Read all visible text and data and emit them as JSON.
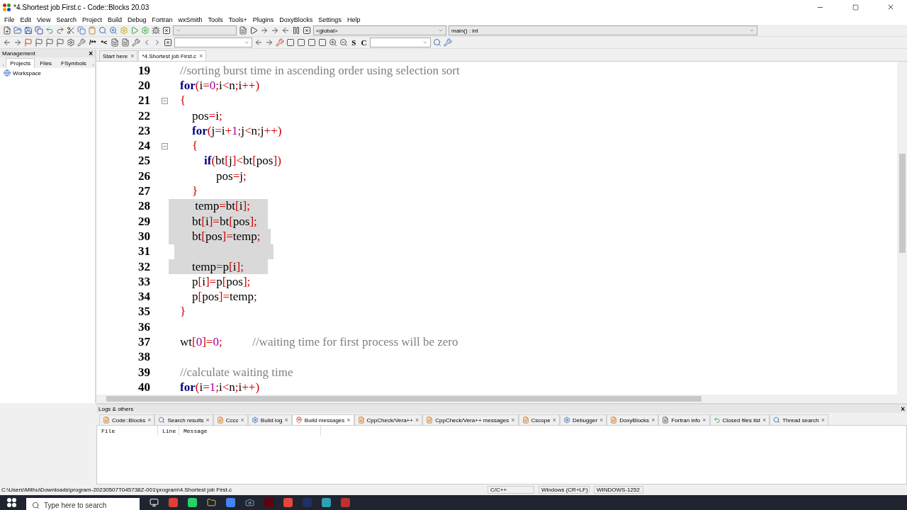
{
  "window": {
    "title": "*4.Shortest job First.c - Code::Blocks 20.03"
  },
  "menu": [
    "File",
    "Edit",
    "View",
    "Search",
    "Project",
    "Build",
    "Debug",
    "Fortran",
    "wxSmith",
    "Tools",
    "Tools+",
    "Plugins",
    "DoxyBlocks",
    "Settings",
    "Help"
  ],
  "toolbar": {
    "scope": "<global>",
    "function": "main() : int",
    "doc_buttons": [
      "/**",
      "*<"
    ],
    "style_buttons": [
      "S",
      "C"
    ]
  },
  "management": {
    "title": "Management",
    "close": "×",
    "tabs": [
      {
        "label": "Projects",
        "selected": true
      },
      {
        "label": "Files",
        "selected": false
      },
      {
        "label": "FSymbols",
        "selected": false
      }
    ],
    "tree": [
      "Workspace"
    ]
  },
  "editor": {
    "tabs": [
      {
        "label": "Start here",
        "close": "×",
        "selected": false
      },
      {
        "label": "*4.Shortest job First.c",
        "close": "×",
        "selected": true
      }
    ],
    "lines": [
      {
        "number": "19",
        "fold": false,
        "selected": false,
        "tokens": [
          {
            "text": "//sorting burst time in ascending order using selection sort",
            "kind": "comment"
          }
        ]
      },
      {
        "number": "20",
        "fold": false,
        "selected": false,
        "tokens": [
          {
            "text": "for",
            "kind": "keyword"
          },
          {
            "text": "(",
            "kind": "operator"
          },
          {
            "text": "i",
            "kind": "plain"
          },
          {
            "text": "=",
            "kind": "operator"
          },
          {
            "text": "0",
            "kind": "number"
          },
          {
            "text": ";",
            "kind": "operator"
          },
          {
            "text": "i",
            "kind": "plain"
          },
          {
            "text": "<",
            "kind": "operator"
          },
          {
            "text": "n",
            "kind": "plain"
          },
          {
            "text": ";",
            "kind": "operator"
          },
          {
            "text": "i",
            "kind": "plain"
          },
          {
            "text": "++)",
            "kind": "operator"
          }
        ]
      },
      {
        "number": "21",
        "fold": true,
        "selected": false,
        "tokens": [
          {
            "text": "{",
            "kind": "operator"
          }
        ]
      },
      {
        "number": "22",
        "fold": false,
        "selected": false,
        "tokens": [
          {
            "text": "    pos",
            "kind": "plain"
          },
          {
            "text": "=",
            "kind": "operator"
          },
          {
            "text": "i",
            "kind": "plain"
          },
          {
            "text": ";",
            "kind": "operator"
          }
        ]
      },
      {
        "number": "23",
        "fold": false,
        "selected": false,
        "tokens": [
          {
            "text": "    for",
            "kind": "keyword"
          },
          {
            "text": "(",
            "kind": "operator"
          },
          {
            "text": "j",
            "kind": "plain"
          },
          {
            "text": "=",
            "kind": "operator"
          },
          {
            "text": "i",
            "kind": "plain"
          },
          {
            "text": "+",
            "kind": "operator"
          },
          {
            "text": "1",
            "kind": "number"
          },
          {
            "text": ";",
            "kind": "operator"
          },
          {
            "text": "j",
            "kind": "plain"
          },
          {
            "text": "<",
            "kind": "operator"
          },
          {
            "text": "n",
            "kind": "plain"
          },
          {
            "text": ";",
            "kind": "operator"
          },
          {
            "text": "j",
            "kind": "plain"
          },
          {
            "text": "++)",
            "kind": "operator"
          }
        ]
      },
      {
        "number": "24",
        "fold": true,
        "selected": false,
        "tokens": [
          {
            "text": "    {",
            "kind": "operator"
          }
        ]
      },
      {
        "number": "25",
        "fold": false,
        "selected": false,
        "tokens": [
          {
            "text": "        if",
            "kind": "keyword"
          },
          {
            "text": "(",
            "kind": "operator"
          },
          {
            "text": "bt",
            "kind": "plain"
          },
          {
            "text": "[",
            "kind": "operator"
          },
          {
            "text": "j",
            "kind": "plain"
          },
          {
            "text": "]<",
            "kind": "operator"
          },
          {
            "text": "bt",
            "kind": "plain"
          },
          {
            "text": "[",
            "kind": "operator"
          },
          {
            "text": "pos",
            "kind": "plain"
          },
          {
            "text": "])",
            "kind": "operator"
          }
        ]
      },
      {
        "number": "26",
        "fold": false,
        "selected": false,
        "tokens": [
          {
            "text": "            pos",
            "kind": "plain"
          },
          {
            "text": "=",
            "kind": "operator"
          },
          {
            "text": "j",
            "kind": "plain"
          },
          {
            "text": ";",
            "kind": "operator"
          }
        ]
      },
      {
        "number": "27",
        "fold": false,
        "selected": false,
        "tokens": [
          {
            "text": "    }",
            "kind": "operator"
          }
        ]
      },
      {
        "number": "28",
        "fold": false,
        "selected": true,
        "tokens": [
          {
            "text": "     temp",
            "kind": "plain"
          },
          {
            "text": "=",
            "kind": "operator"
          },
          {
            "text": "bt",
            "kind": "plain"
          },
          {
            "text": "[",
            "kind": "operator"
          },
          {
            "text": "i",
            "kind": "plain"
          },
          {
            "text": "];",
            "kind": "operator"
          }
        ]
      },
      {
        "number": "29",
        "fold": false,
        "selected": true,
        "tokens": [
          {
            "text": "    bt",
            "kind": "plain"
          },
          {
            "text": "[",
            "kind": "operator"
          },
          {
            "text": "i",
            "kind": "plain"
          },
          {
            "text": "]=",
            "kind": "operator"
          },
          {
            "text": "bt",
            "kind": "plain"
          },
          {
            "text": "[",
            "kind": "operator"
          },
          {
            "text": "pos",
            "kind": "plain"
          },
          {
            "text": "];",
            "kind": "operator"
          }
        ]
      },
      {
        "number": "30",
        "fold": false,
        "selected": true,
        "tokens": [
          {
            "text": "    bt",
            "kind": "plain"
          },
          {
            "text": "[",
            "kind": "operator"
          },
          {
            "text": "pos",
            "kind": "plain"
          },
          {
            "text": "]=",
            "kind": "operator"
          },
          {
            "text": "temp",
            "kind": "plain"
          },
          {
            "text": ";",
            "kind": "operator"
          }
        ]
      },
      {
        "number": "31",
        "fold": false,
        "selected": true
      },
      {
        "number": "32",
        "fold": false,
        "selected": true,
        "tokens": [
          {
            "text": "    temp",
            "kind": "plain"
          },
          {
            "text": "=",
            "kind": "operator"
          },
          {
            "text": "p",
            "kind": "plain"
          },
          {
            "text": "[",
            "kind": "operator"
          },
          {
            "text": "i",
            "kind": "plain"
          },
          {
            "text": "];",
            "kind": "operator"
          }
        ]
      },
      {
        "number": "33",
        "fold": false,
        "selected": false,
        "tokens": [
          {
            "text": "    p",
            "kind": "plain"
          },
          {
            "text": "[",
            "kind": "operator"
          },
          {
            "text": "i",
            "kind": "plain"
          },
          {
            "text": "]=",
            "kind": "operator"
          },
          {
            "text": "p",
            "kind": "plain"
          },
          {
            "text": "[",
            "kind": "operator"
          },
          {
            "text": "pos",
            "kind": "plain"
          },
          {
            "text": "];",
            "kind": "operator"
          }
        ]
      },
      {
        "number": "34",
        "fold": false,
        "selected": false,
        "tokens": [
          {
            "text": "    p",
            "kind": "plain"
          },
          {
            "text": "[",
            "kind": "operator"
          },
          {
            "text": "pos",
            "kind": "plain"
          },
          {
            "text": "]=",
            "kind": "operator"
          },
          {
            "text": "temp",
            "kind": "plain"
          },
          {
            "text": ";",
            "kind": "operator"
          }
        ]
      },
      {
        "number": "35",
        "fold": false,
        "selected": false,
        "tokens": [
          {
            "text": "}",
            "kind": "operator"
          }
        ]
      },
      {
        "number": "36",
        "fold": false,
        "selected": false
      },
      {
        "number": "37",
        "fold": false,
        "selected": false,
        "tokens": [
          {
            "text": "wt",
            "kind": "plain"
          },
          {
            "text": "[",
            "kind": "operator"
          },
          {
            "text": "0",
            "kind": "number"
          },
          {
            "text": "]=",
            "kind": "operator"
          },
          {
            "text": "0",
            "kind": "number"
          },
          {
            "text": ";",
            "kind": "operator"
          },
          {
            "text": "          //waiting time for first process will be zero",
            "kind": "comment"
          }
        ]
      },
      {
        "number": "38",
        "fold": false,
        "selected": false
      },
      {
        "number": "39",
        "fold": false,
        "selected": false,
        "tokens": [
          {
            "text": "//calculate waiting time",
            "kind": "comment"
          }
        ]
      },
      {
        "number": "40",
        "fold": false,
        "selected": false,
        "tokens": [
          {
            "text": "for",
            "kind": "keyword"
          },
          {
            "text": "(",
            "kind": "operator"
          },
          {
            "text": "i",
            "kind": "plain"
          },
          {
            "text": "=",
            "kind": "operator"
          },
          {
            "text": "1",
            "kind": "number"
          },
          {
            "text": ";",
            "kind": "operator"
          },
          {
            "text": "i",
            "kind": "plain"
          },
          {
            "text": "<",
            "kind": "operator"
          },
          {
            "text": "n",
            "kind": "plain"
          },
          {
            "text": ";",
            "kind": "operator"
          },
          {
            "text": "i",
            "kind": "plain"
          },
          {
            "text": "++)",
            "kind": "operator"
          }
        ]
      }
    ]
  },
  "logs": {
    "title": "Logs & others",
    "close": "×",
    "tabs": [
      {
        "label": "Code::Blocks",
        "close": "×",
        "selected": false,
        "kind": "doc"
      },
      {
        "label": "Search results",
        "close": "×",
        "selected": false,
        "kind": "search"
      },
      {
        "label": "Cccc",
        "close": "×",
        "selected": false,
        "kind": "doc"
      },
      {
        "label": "Build log",
        "close": "×",
        "selected": false,
        "kind": "gear"
      },
      {
        "label": "Build messages",
        "close": "×",
        "selected": true,
        "kind": "pin"
      },
      {
        "label": "CppCheck/Vera++",
        "close": "×",
        "selected": false,
        "kind": "doc"
      },
      {
        "label": "CppCheck/Vera++ messages",
        "close": "×",
        "selected": false,
        "kind": "doc"
      },
      {
        "label": "Cscope",
        "close": "×",
        "selected": false,
        "kind": "doc"
      },
      {
        "label": "Debugger",
        "close": "×",
        "selected": false,
        "kind": "gear"
      },
      {
        "label": "DoxyBlocks",
        "close": "×",
        "selected": false,
        "kind": "doc"
      },
      {
        "label": "Fortran info",
        "close": "×",
        "selected": false,
        "kind": "file"
      },
      {
        "label": "Closed files list",
        "close": "×",
        "selected": false,
        "kind": "undo"
      },
      {
        "label": "Thread search",
        "close": "×",
        "selected": false,
        "kind": "search"
      }
    ],
    "columns": [
      "File",
      "Line",
      "Message"
    ]
  },
  "status_bar": {
    "path": "C:\\Users\\Mithu\\Downloads\\program-20230507T045738Z-001\\program\\4.Shortest job First.c",
    "language": "C/C++",
    "line_endings": "Windows (CR+LF)",
    "encoding": "WINDOWS-1252"
  },
  "taskbar": {
    "search_placeholder": "Type here to search"
  }
}
